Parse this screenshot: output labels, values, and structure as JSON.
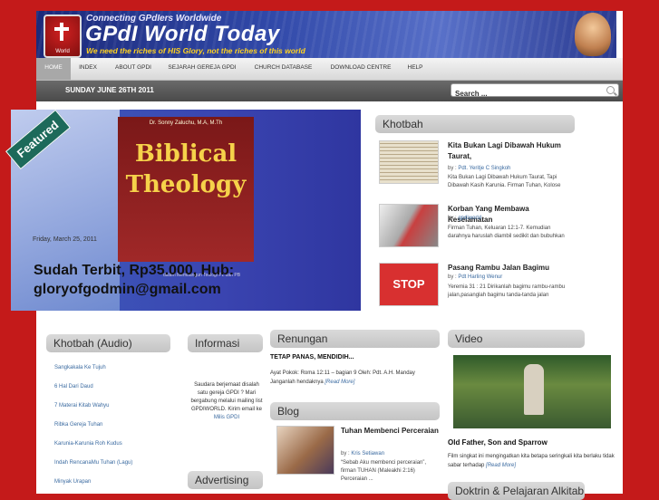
{
  "header": {
    "tagline_top": "Connecting GPdIers Worldwide",
    "title": "GPdI World Today",
    "tagline_bottom": "We need the riches of HIS Glory, not the riches of this world",
    "logo_label": "World"
  },
  "nav": {
    "items": [
      {
        "label": "HOME",
        "active": true
      },
      {
        "label": "INDEX"
      },
      {
        "label": "ABOUT GPDI"
      },
      {
        "label": "SEJARAH GEREJA GPDI"
      },
      {
        "label": "CHURCH DATABASE"
      },
      {
        "label": "DOWNLOAD CENTRE"
      },
      {
        "label": "HELP"
      }
    ]
  },
  "datebar": {
    "date": "SUNDAY JUNE 26TH 2011",
    "search_value": "Search ..."
  },
  "featured": {
    "ribbon": "Featured",
    "author": "Dr. Sonny Zaluchu, M.A, M.Th",
    "book_title_1": "Biblical",
    "book_title_2": "Theology",
    "book_subtitle": "dalam Membangun Teologi PL dan PB",
    "date": "Friday, March 25, 2011",
    "headline_1": "Sudah Terbit, Rp35.000, Hub:",
    "headline_2": "gloryofgodmin@gmail.com"
  },
  "khotbah": {
    "heading": "Khotbah",
    "items": [
      {
        "title": "Kita Bukan Lagi Dibawah Hukum Taurat,",
        "by": "by :",
        "author": "Pdt. Yeritje C Singkoh",
        "body": "Kita Bukan Lagi Dibawah Hukum Taurat, Tapi Dibawah Kasih Karunia. Firman Tuhan, Kolose"
      },
      {
        "title": "Korban Yang Membawa Keselamatan",
        "by": "by :",
        "author": "gpdiworld",
        "body": "Firman Tuhan, Keluaran 12:1-7. Kemudian darahnya haruslah diambil sedikit dan bubuhkan"
      },
      {
        "title": "Pasang Rambu Jalan Bagimu",
        "by": "by :",
        "author": "Pdt Harling Wenur",
        "body": "Yeremia 31 : 21 Dirikanlah bagimu rambu-rambu jalan,pasanglah bagimu tanda-tanda jalan",
        "thumb_text": "STOP"
      }
    ]
  },
  "audio": {
    "heading": "Khotbah (Audio)",
    "links": [
      "Sangkakala Ke Tujuh",
      "6 Hal Dari Daud",
      "7 Materai Kitab Wahyu",
      "Ribka Gereja Tuhan",
      "Karunia-Karunia Roh Kudus",
      "Indah RencanaMu Tuhan (Lagu)",
      "Minyak Urapan"
    ]
  },
  "informasi": {
    "heading": "Informasi",
    "text": "Saudara berjemaat disalah satu gereja GPDI ? Mari bergabung melalui mailing list GPDIWORLD. Kirim email ke",
    "link": "Milis GPDI"
  },
  "advertising": {
    "heading": "Advertising"
  },
  "renungan": {
    "heading": "Renungan",
    "title": "TETAP PANAS, MENDIDIH...",
    "body": "Ayat Pokok: Roma 12:11 – bagian 9 Oleh: Pdt. A.H. Manday Janganlah hendaknya",
    "more": "[Read More]"
  },
  "blog": {
    "heading": "Blog",
    "title": "Tuhan Membenci Perceraian",
    "by": "by :",
    "author": "Kris Setiawan",
    "body": "“Sebab Aku membenci perceraian”, firman TUHAN (Maleakhi 2:16) Perceraian ..."
  },
  "video": {
    "heading": "Video",
    "title": "Old Father, Son and Sparrow",
    "desc": "Film singkat ini mengingatkan kita betapa seringkali kita berlaku tidak sabar terhadap",
    "more": "[Read More]"
  },
  "doktrin": {
    "heading": "Doktrin & Pelajaran Alkitab"
  }
}
